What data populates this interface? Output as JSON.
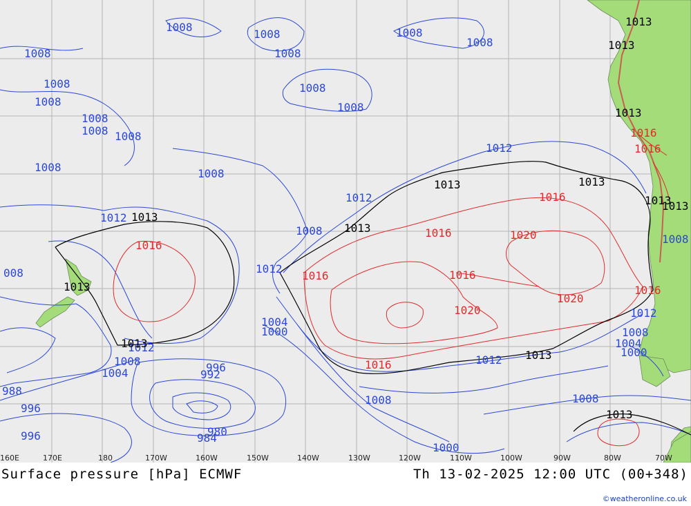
{
  "footer": {
    "title": "Surface pressure [hPa] ECMWF",
    "valid_time": "Th 13-02-2025 12:00 UTC (00+348)",
    "credit": "©weatheronline.co.uk"
  },
  "longitude_labels": [
    "160E",
    "170E",
    "180",
    "170W",
    "160W",
    "150W",
    "140W",
    "130W",
    "120W",
    "110W",
    "100W",
    "90W",
    "80W",
    "70W"
  ],
  "colors": {
    "background": "#ececec",
    "land": "#a4dc7a",
    "grid": "#b4b4b4",
    "isobar_low": "#2a47d6",
    "isobar_high": "#e02b2b",
    "isobar_ref": "#000000"
  },
  "isobar_labels": {
    "b1008": "1008",
    "b1012": "1012",
    "b1004": "1004",
    "b1000": "1000",
    "b996": "996",
    "b992": "992",
    "b988": "988",
    "b984": "984",
    "b980": "980",
    "k1013": "1013",
    "r1016": "1016",
    "r1020": "1020",
    "b008": "008"
  }
}
